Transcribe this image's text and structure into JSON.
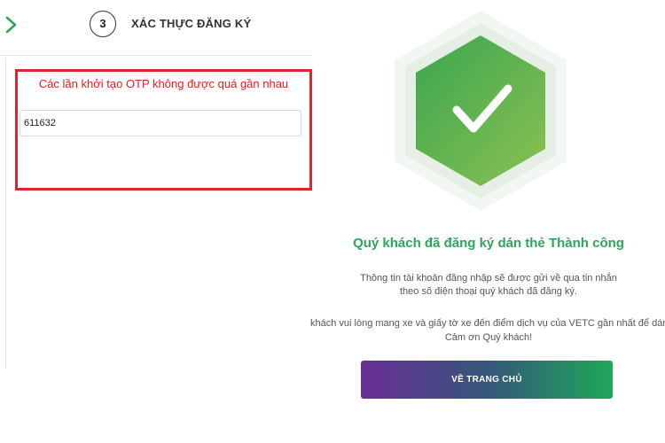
{
  "step": {
    "number": "3",
    "title": "XÁC THỰC ĐĂNG KÝ"
  },
  "otp": {
    "error_message": "Các lần khởi tạo OTP không được quá gần nhau",
    "value": "611632"
  },
  "success": {
    "title": "Quý khách đã đăng ký dán thẻ Thành công",
    "info_line_1": "Thông tin tài khoản đăng nhập sẽ được gửi về qua tin nhắn",
    "info_line_2": "theo số điện thoại quý khách đã đăng ký.",
    "info_line_3": "khách vui lòng mang xe và giấy tờ xe đến điểm dịch vụ của VETC gần nhất để dán",
    "info_line_4": "Cảm ơn Quý khách!",
    "home_button_label": "VỀ TRANG CHỦ"
  },
  "icons": {
    "back": "chevron-right-icon",
    "success": "check-hexagon-icon"
  },
  "colors": {
    "accent_green": "#2ea55c",
    "error_red": "#d9272e",
    "button_gradient_start": "#6a2f98",
    "button_gradient_end": "#1fa85a"
  }
}
